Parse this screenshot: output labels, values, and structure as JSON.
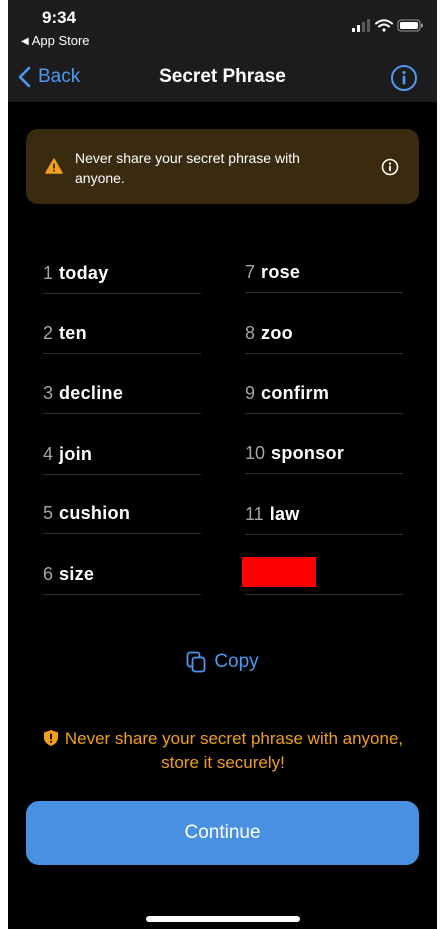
{
  "status_bar": {
    "time": "9:34",
    "back_app": "App Store"
  },
  "nav": {
    "back_label": "Back",
    "title": "Secret Phrase"
  },
  "warning_banner": {
    "text": "Never share your secret phrase with anyone."
  },
  "words": [
    {
      "num": "1",
      "word": "today"
    },
    {
      "num": "2",
      "word": "ten"
    },
    {
      "num": "3",
      "word": "decline"
    },
    {
      "num": "4",
      "word": "join"
    },
    {
      "num": "5",
      "word": "cushion"
    },
    {
      "num": "6",
      "word": "size"
    },
    {
      "num": "7",
      "word": "rose"
    },
    {
      "num": "8",
      "word": "zoo"
    },
    {
      "num": "9",
      "word": "confirm"
    },
    {
      "num": "10",
      "word": "sponsor"
    },
    {
      "num": "11",
      "word": "law"
    }
  ],
  "copy_label": "Copy",
  "bottom_warning": "Never share your secret phrase with anyone, store it securely!",
  "continue_label": "Continue",
  "colors": {
    "accent": "#4a9bf0",
    "warning": "#f29e1f",
    "button": "#4890e2",
    "redaction": "#ff0000"
  }
}
